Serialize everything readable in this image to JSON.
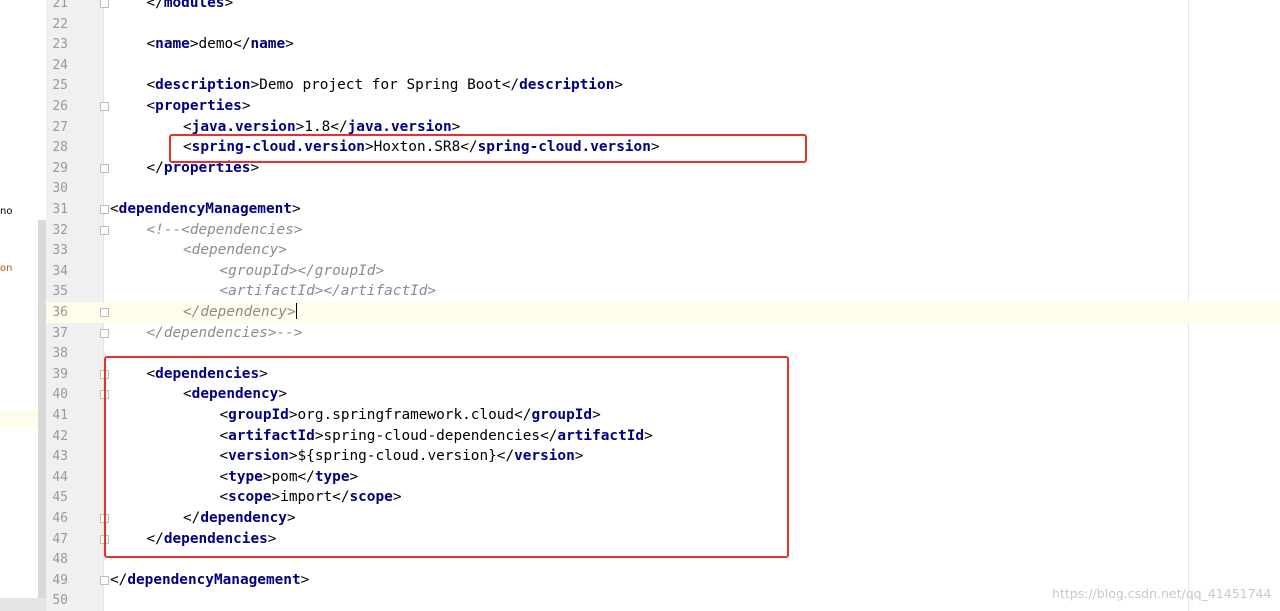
{
  "sidebar_fragments": [
    "no",
    "on"
  ],
  "lines": [
    {
      "n": "21",
      "indent": 1,
      "parts": [
        [
          "br",
          "</"
        ],
        [
          "tag",
          "modules"
        ],
        [
          "br",
          ">"
        ]
      ]
    },
    {
      "n": "22",
      "indent": 0,
      "parts": []
    },
    {
      "n": "23",
      "indent": 1,
      "parts": [
        [
          "br",
          "<"
        ],
        [
          "tag",
          "name"
        ],
        [
          "br",
          ">"
        ],
        [
          "txt",
          "demo"
        ],
        [
          "br",
          "</"
        ],
        [
          "tag",
          "name"
        ],
        [
          "br",
          ">"
        ]
      ]
    },
    {
      "n": "24",
      "indent": 0,
      "parts": []
    },
    {
      "n": "25",
      "indent": 1,
      "parts": [
        [
          "br",
          "<"
        ],
        [
          "tag",
          "description"
        ],
        [
          "br",
          ">"
        ],
        [
          "txt",
          "Demo project for Spring Boot"
        ],
        [
          "br",
          "</"
        ],
        [
          "tag",
          "description"
        ],
        [
          "br",
          ">"
        ]
      ]
    },
    {
      "n": "26",
      "indent": 1,
      "parts": [
        [
          "br",
          "<"
        ],
        [
          "tag",
          "properties"
        ],
        [
          "br",
          ">"
        ]
      ]
    },
    {
      "n": "27",
      "indent": 2,
      "parts": [
        [
          "br",
          "<"
        ],
        [
          "tag",
          "java.version"
        ],
        [
          "br",
          ">"
        ],
        [
          "txt",
          "1.8"
        ],
        [
          "br",
          "</"
        ],
        [
          "tag",
          "java.version"
        ],
        [
          "br",
          ">"
        ]
      ]
    },
    {
      "n": "28",
      "indent": 2,
      "parts": [
        [
          "br",
          "<"
        ],
        [
          "tag",
          "spring-cloud.version"
        ],
        [
          "br",
          ">"
        ],
        [
          "txt",
          "Hoxton.SR8"
        ],
        [
          "br",
          "</"
        ],
        [
          "tag",
          "spring-cloud.version"
        ],
        [
          "br",
          ">"
        ]
      ]
    },
    {
      "n": "29",
      "indent": 1,
      "parts": [
        [
          "br",
          "</"
        ],
        [
          "tag",
          "properties"
        ],
        [
          "br",
          ">"
        ]
      ]
    },
    {
      "n": "30",
      "indent": 0,
      "parts": []
    },
    {
      "n": "31",
      "indent": 0,
      "parts": [
        [
          "br",
          "<"
        ],
        [
          "tag",
          "dependencyManagement"
        ],
        [
          "br",
          ">"
        ]
      ]
    },
    {
      "n": "32",
      "indent": 1,
      "parts": [
        [
          "cmt",
          "<!--<dependencies>"
        ]
      ]
    },
    {
      "n": "33",
      "indent": 2,
      "parts": [
        [
          "cmt",
          "<dependency>"
        ]
      ]
    },
    {
      "n": "34",
      "indent": 3,
      "parts": [
        [
          "cmt",
          "<groupId></groupId>"
        ]
      ]
    },
    {
      "n": "35",
      "indent": 3,
      "parts": [
        [
          "cmt",
          "<artifactId></artifactId>"
        ]
      ]
    },
    {
      "n": "36",
      "indent": 2,
      "parts": [
        [
          "cmt",
          "</dependency>"
        ]
      ]
    },
    {
      "n": "37",
      "indent": 1,
      "parts": [
        [
          "cmt",
          "</dependencies>-->"
        ]
      ]
    },
    {
      "n": "38",
      "indent": 0,
      "parts": []
    },
    {
      "n": "39",
      "indent": 1,
      "parts": [
        [
          "br",
          "<"
        ],
        [
          "tag",
          "dependencies"
        ],
        [
          "br",
          ">"
        ]
      ]
    },
    {
      "n": "40",
      "indent": 2,
      "parts": [
        [
          "br",
          "<"
        ],
        [
          "tag",
          "dependency"
        ],
        [
          "br",
          ">"
        ]
      ]
    },
    {
      "n": "41",
      "indent": 3,
      "parts": [
        [
          "br",
          "<"
        ],
        [
          "tag",
          "groupId"
        ],
        [
          "br",
          ">"
        ],
        [
          "txt",
          "org.springframework.cloud"
        ],
        [
          "br",
          "</"
        ],
        [
          "tag",
          "groupId"
        ],
        [
          "br",
          ">"
        ]
      ]
    },
    {
      "n": "42",
      "indent": 3,
      "parts": [
        [
          "br",
          "<"
        ],
        [
          "tag",
          "artifactId"
        ],
        [
          "br",
          ">"
        ],
        [
          "txt",
          "spring-cloud-dependencies"
        ],
        [
          "br",
          "</"
        ],
        [
          "tag",
          "artifactId"
        ],
        [
          "br",
          ">"
        ]
      ]
    },
    {
      "n": "43",
      "indent": 3,
      "parts": [
        [
          "br",
          "<"
        ],
        [
          "tag",
          "version"
        ],
        [
          "br",
          ">"
        ],
        [
          "txt",
          "${spring-cloud.version}"
        ],
        [
          "br",
          "</"
        ],
        [
          "tag",
          "version"
        ],
        [
          "br",
          ">"
        ]
      ]
    },
    {
      "n": "44",
      "indent": 3,
      "parts": [
        [
          "br",
          "<"
        ],
        [
          "tag",
          "type"
        ],
        [
          "br",
          ">"
        ],
        [
          "txt",
          "pom"
        ],
        [
          "br",
          "</"
        ],
        [
          "tag",
          "type"
        ],
        [
          "br",
          ">"
        ]
      ]
    },
    {
      "n": "45",
      "indent": 3,
      "parts": [
        [
          "br",
          "<"
        ],
        [
          "tag",
          "scope"
        ],
        [
          "br",
          ">"
        ],
        [
          "txt",
          "import"
        ],
        [
          "br",
          "</"
        ],
        [
          "tag",
          "scope"
        ],
        [
          "br",
          ">"
        ]
      ]
    },
    {
      "n": "46",
      "indent": 2,
      "parts": [
        [
          "br",
          "</"
        ],
        [
          "tag",
          "dependency"
        ],
        [
          "br",
          ">"
        ]
      ]
    },
    {
      "n": "47",
      "indent": 1,
      "parts": [
        [
          "br",
          "</"
        ],
        [
          "tag",
          "dependencies"
        ],
        [
          "br",
          ">"
        ]
      ]
    },
    {
      "n": "48",
      "indent": 0,
      "parts": []
    },
    {
      "n": "49",
      "indent": 0,
      "parts": [
        [
          "br",
          "</"
        ],
        [
          "tag",
          "dependencyManagement"
        ],
        [
          "br",
          ">"
        ]
      ]
    },
    {
      "n": "50",
      "indent": 0,
      "parts": []
    }
  ],
  "current_line": "36",
  "fold_open": [
    "26",
    "31",
    "32",
    "39",
    "40"
  ],
  "fold_close": [
    "21",
    "29",
    "36",
    "37",
    "46",
    "47",
    "49"
  ],
  "colors": {
    "tag": "#000080",
    "comment": "#8c8c8c",
    "highlight_box": "#e8302c",
    "current_line": "#fefcea"
  },
  "watermark": "https://blog.csdn.net/qq_41451744"
}
